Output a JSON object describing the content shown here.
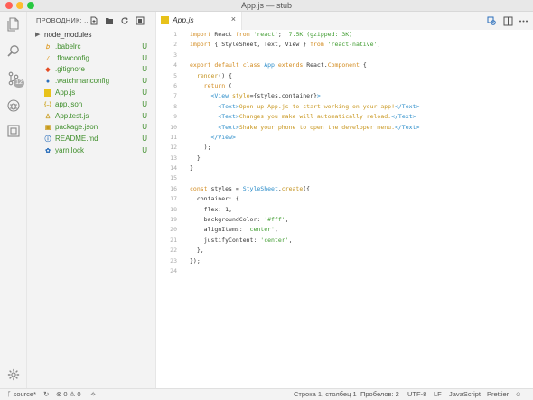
{
  "window": {
    "title": "App.js — stub"
  },
  "activity_bar": {
    "items": [
      {
        "icon": "files-icon"
      },
      {
        "icon": "search-icon"
      },
      {
        "icon": "source-control-icon",
        "badge": "12"
      },
      {
        "icon": "debug-icon"
      },
      {
        "icon": "extensions-icon"
      }
    ],
    "settings_icon": "gear-icon"
  },
  "sidebar": {
    "title": "ПРОВОДНИК: ...",
    "files": [
      {
        "name": "node_modules",
        "icon": "chevron-right-icon",
        "status": "",
        "folder": true
      },
      {
        "name": ".babelrc",
        "icon": "babel-file-icon",
        "status": "U",
        "color": "#e0a030"
      },
      {
        "name": ".flowconfig",
        "icon": "flow-file-icon",
        "status": "U",
        "color": "#e0a030"
      },
      {
        "name": ".gitignore",
        "icon": "git-file-icon",
        "status": "U",
        "color": "#e44d26"
      },
      {
        "name": ".watchmanconfig",
        "icon": "config-file-icon",
        "status": "U",
        "color": "#2a6ebb"
      },
      {
        "name": "App.js",
        "icon": "js-file-icon",
        "status": "U",
        "color": "#e8c21a"
      },
      {
        "name": "app.json",
        "icon": "json-file-icon",
        "status": "U",
        "color": "#cba21a",
        "glyph": "{..}"
      },
      {
        "name": "App.test.js",
        "icon": "test-file-icon",
        "status": "U",
        "color": "#c89a18"
      },
      {
        "name": "package.json",
        "icon": "npm-file-icon",
        "status": "U",
        "color": "#c89a18"
      },
      {
        "name": "README.md",
        "icon": "info-file-icon",
        "status": "U",
        "color": "#2a6ebb"
      },
      {
        "name": "yarn.lock",
        "icon": "yarn-file-icon",
        "status": "U",
        "color": "#2a6ebb"
      }
    ]
  },
  "editor": {
    "tab": {
      "label": "App.js",
      "close": "×"
    },
    "code_lines": [
      [
        [
          "kw",
          "import"
        ],
        [
          "t",
          " React "
        ],
        [
          "kw",
          "from"
        ],
        [
          "t",
          " "
        ],
        [
          "str",
          "'react'"
        ],
        [
          "t",
          ";  "
        ],
        [
          "info",
          "7.5K (gzipped: 3K)"
        ]
      ],
      [
        [
          "kw",
          "import"
        ],
        [
          "t",
          " { StyleSheet, Text, View } "
        ],
        [
          "kw",
          "from"
        ],
        [
          "t",
          " "
        ],
        [
          "str",
          "'react-native'"
        ],
        [
          "t",
          ";"
        ]
      ],
      [],
      [
        [
          "kw",
          "export default class"
        ],
        [
          "t",
          " "
        ],
        [
          "tag",
          "App"
        ],
        [
          "t",
          " "
        ],
        [
          "kw",
          "extends"
        ],
        [
          "t",
          " React."
        ],
        [
          "cls",
          "Component"
        ],
        [
          "t",
          " {"
        ]
      ],
      [
        [
          "t",
          "  "
        ],
        [
          "fn",
          "render"
        ],
        [
          "t",
          "() {"
        ]
      ],
      [
        [
          "t",
          "    "
        ],
        [
          "kw",
          "return"
        ],
        [
          "t",
          " ("
        ]
      ],
      [
        [
          "t",
          "      "
        ],
        [
          "tag",
          "<View"
        ],
        [
          "t",
          " "
        ],
        [
          "jsx",
          "style"
        ],
        [
          "t",
          "={styles.container}"
        ],
        [
          "tag",
          ">"
        ]
      ],
      [
        [
          "t",
          "        "
        ],
        [
          "tag",
          "<Text>"
        ],
        [
          "jsx",
          "Open up App.js to start working on your app!"
        ],
        [
          "tag",
          "</Text>"
        ]
      ],
      [
        [
          "t",
          "        "
        ],
        [
          "tag",
          "<Text>"
        ],
        [
          "jsx",
          "Changes you make will automatically reload."
        ],
        [
          "tag",
          "</Text>"
        ]
      ],
      [
        [
          "t",
          "        "
        ],
        [
          "tag",
          "<Text>"
        ],
        [
          "jsx",
          "Shake your phone to open the developer menu."
        ],
        [
          "tag",
          "</Text>"
        ]
      ],
      [
        [
          "t",
          "      "
        ],
        [
          "tag",
          "</View>"
        ]
      ],
      [
        [
          "t",
          "    );"
        ]
      ],
      [
        [
          "t",
          "  }"
        ]
      ],
      [
        [
          "t",
          "}"
        ]
      ],
      [],
      [
        [
          "kw",
          "const"
        ],
        [
          "t",
          " styles = "
        ],
        [
          "tag",
          "StyleSheet"
        ],
        [
          "t",
          "."
        ],
        [
          "fn",
          "create"
        ],
        [
          "t",
          "({"
        ]
      ],
      [
        [
          "t",
          "  container: {"
        ]
      ],
      [
        [
          "t",
          "    flex: "
        ],
        [
          "num",
          "1"
        ],
        [
          "t",
          ","
        ]
      ],
      [
        [
          "t",
          "    backgroundColor: "
        ],
        [
          "str",
          "'#fff'"
        ],
        [
          "t",
          ","
        ]
      ],
      [
        [
          "t",
          "    alignItems: "
        ],
        [
          "str",
          "'center'"
        ],
        [
          "t",
          ","
        ]
      ],
      [
        [
          "t",
          "    justifyContent: "
        ],
        [
          "str",
          "'center'"
        ],
        [
          "t",
          ","
        ]
      ],
      [
        [
          "t",
          "  },"
        ]
      ],
      [
        [
          "t",
          "});"
        ]
      ],
      []
    ]
  },
  "statusbar": {
    "branch": "source*",
    "problems": "⊗ 0 ⚠ 0",
    "position": "Строка 1, столбец 1",
    "spaces": "Пробелов: 2",
    "encoding": "UTF-8",
    "eol": "LF",
    "language": "JavaScript",
    "formatter": "Prettier"
  }
}
